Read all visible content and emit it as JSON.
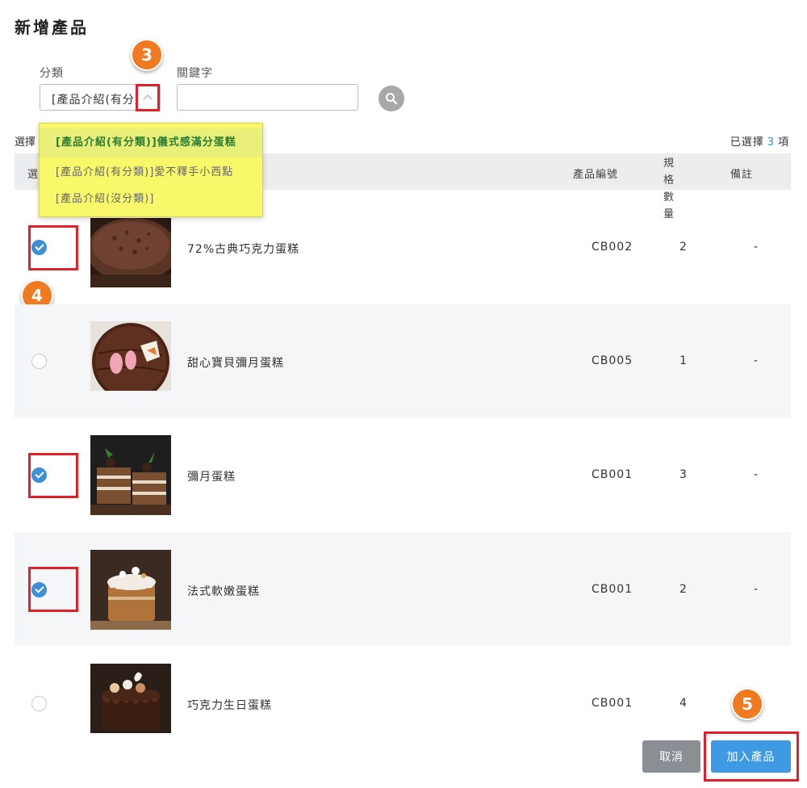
{
  "page": {
    "title": "新增產品"
  },
  "filters": {
    "category_label": "分類",
    "category_value": "[產品介紹(有分類]",
    "keyword_label": "關鍵字",
    "keyword_value": "",
    "keyword_placeholder": ""
  },
  "dropdown": {
    "options": [
      {
        "label": "[產品介紹(有分類)]儀式感滿分蛋糕",
        "active": true
      },
      {
        "label": "[產品介紹(有分類)]愛不釋手小西點",
        "active": false
      },
      {
        "label": "[產品介紹(沒分類)]",
        "active": false
      }
    ]
  },
  "selection": {
    "left_label": "選擇",
    "prefix": "已選擇",
    "count": "3",
    "suffix": "項"
  },
  "table": {
    "headers": {
      "select": "選擇",
      "code": "產品編號",
      "spec_line1": "規格",
      "spec_line2": "數量",
      "note": "備註"
    },
    "rows": [
      {
        "name": "72%古典巧克力蛋糕",
        "code": "CB002",
        "qty": "2",
        "note": "-",
        "checked": true,
        "image": "chocolate-cake-photo"
      },
      {
        "name": "甜心寶貝彌月蛋糕",
        "code": "CB005",
        "qty": "1",
        "note": "-",
        "checked": false,
        "image": "baby-feet-cake-photo"
      },
      {
        "name": "彌月蛋糕",
        "code": "CB001",
        "qty": "3",
        "note": "-",
        "checked": true,
        "image": "layer-cake-photo"
      },
      {
        "name": "法式軟嫩蛋糕",
        "code": "CB001",
        "qty": "2",
        "note": "-",
        "checked": true,
        "image": "french-cake-photo"
      },
      {
        "name": "巧克力生日蛋糕",
        "code": "CB001",
        "qty": "4",
        "note": "",
        "checked": false,
        "image": "birthday-cake-photo"
      }
    ]
  },
  "buttons": {
    "cancel": "取消",
    "add": "加入產品"
  },
  "annotations": {
    "step3": "3",
    "step4": "4",
    "step5": "5"
  },
  "colors": {
    "accent": "#3f8fd6",
    "highlight_red": "#e0202a",
    "badge_orange": "#f07a20",
    "dropdown_yellow": "#f8f86a"
  }
}
